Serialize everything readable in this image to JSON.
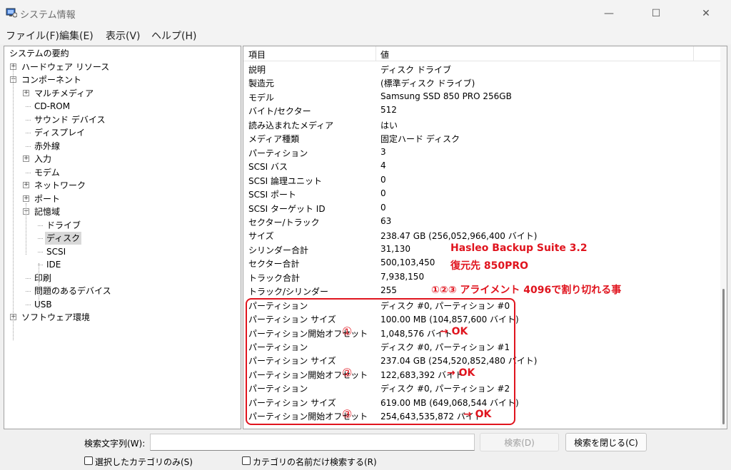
{
  "window": {
    "title": "システム情報",
    "minimize": "—",
    "maximize": "☐",
    "close": "✕"
  },
  "menu": [
    "ファイル(F)",
    "編集(E)",
    "表示(V)",
    "ヘルプ(H)"
  ],
  "tree": [
    {
      "label": "システムの要約",
      "level": 0,
      "exp": ""
    },
    {
      "label": "ハードウェア リソース",
      "level": 1,
      "exp": "+"
    },
    {
      "label": "コンポーネント",
      "level": 1,
      "exp": "−"
    },
    {
      "label": "マルチメディア",
      "level": 2,
      "exp": "+"
    },
    {
      "label": "CD-ROM",
      "level": 2,
      "exp": ""
    },
    {
      "label": "サウンド デバイス",
      "level": 2,
      "exp": ""
    },
    {
      "label": "ディスプレイ",
      "level": 2,
      "exp": ""
    },
    {
      "label": "赤外線",
      "level": 2,
      "exp": ""
    },
    {
      "label": "入力",
      "level": 2,
      "exp": "+"
    },
    {
      "label": "モデム",
      "level": 2,
      "exp": ""
    },
    {
      "label": "ネットワーク",
      "level": 2,
      "exp": "+"
    },
    {
      "label": "ポート",
      "level": 2,
      "exp": "+"
    },
    {
      "label": "記憶域",
      "level": 2,
      "exp": "−"
    },
    {
      "label": "ドライブ",
      "level": 3,
      "exp": ""
    },
    {
      "label": "ディスク",
      "level": 3,
      "exp": "",
      "selected": true
    },
    {
      "label": "SCSI",
      "level": 3,
      "exp": ""
    },
    {
      "label": "IDE",
      "level": 3,
      "exp": ""
    },
    {
      "label": "印刷",
      "level": 2,
      "exp": ""
    },
    {
      "label": "問題のあるデバイス",
      "level": 2,
      "exp": ""
    },
    {
      "label": "USB",
      "level": 2,
      "exp": ""
    },
    {
      "label": "ソフトウェア環境",
      "level": 1,
      "exp": "+"
    }
  ],
  "columns": {
    "item": "項目",
    "value": "値"
  },
  "rows": [
    {
      "item": "説明",
      "value": "ディスク ドライブ"
    },
    {
      "item": "製造元",
      "value": "(標準ディスク ドライブ)"
    },
    {
      "item": "モデル",
      "value": "Samsung SSD 850 PRO 256GB"
    },
    {
      "item": "バイト/セクター",
      "value": "512"
    },
    {
      "item": "読み込まれたメディア",
      "value": "はい"
    },
    {
      "item": "メディア種類",
      "value": "固定ハード ディスク"
    },
    {
      "item": "パーティション",
      "value": "3"
    },
    {
      "item": "SCSI バス",
      "value": "4"
    },
    {
      "item": "SCSI 論理ユニット",
      "value": "0"
    },
    {
      "item": "SCSI ポート",
      "value": "0"
    },
    {
      "item": "SCSI ターゲット ID",
      "value": "0"
    },
    {
      "item": "セクター/トラック",
      "value": "63"
    },
    {
      "item": "サイズ",
      "value": "238.47 GB (256,052,966,400 バイト)"
    },
    {
      "item": "シリンダー合計",
      "value": "31,130"
    },
    {
      "item": "セクター合計",
      "value": "500,103,450"
    },
    {
      "item": "トラック合計",
      "value": "7,938,150"
    },
    {
      "item": "トラック/シリンダー",
      "value": "255"
    },
    {
      "item": "パーティション",
      "value": "ディスク #0, パーティション #0"
    },
    {
      "item": "パーティション サイズ",
      "value": "100.00 MB (104,857,600 バイト)"
    },
    {
      "item": "パーティション開始オフセット",
      "value": "1,048,576 バイト",
      "mark": "①",
      "ok": "→ OK"
    },
    {
      "item": "パーティション",
      "value": "ディスク #0, パーティション #1"
    },
    {
      "item": "パーティション サイズ",
      "value": "237.04 GB (254,520,852,480 バイト)"
    },
    {
      "item": "パーティション開始オフセット",
      "value": "122,683,392 バイト",
      "mark": "②",
      "ok": "→ OK"
    },
    {
      "item": "パーティション",
      "value": "ディスク #0, パーティション #2"
    },
    {
      "item": "パーティション サイズ",
      "value": "619.00 MB (649,068,544 バイト)"
    },
    {
      "item": "パーティション開始オフセット",
      "value": "254,643,535,872 バイト",
      "mark": "③",
      "ok": "→ OK"
    }
  ],
  "annotations": {
    "line1": "Hasleo Backup Suite 3.2",
    "line2": "復元先 850PRO",
    "line3": "①②③ アライメント 4096で割り切れる事"
  },
  "search": {
    "label": "検索文字列(W):",
    "value": "",
    "find_button": "検索(D)",
    "close_button": "検索を閉じる(C)",
    "opt1": "選択したカテゴリのみ(S)",
    "opt2": "カテゴリの名前だけ検索する(R)"
  },
  "colors": {
    "accent_red": "#e0141e"
  }
}
